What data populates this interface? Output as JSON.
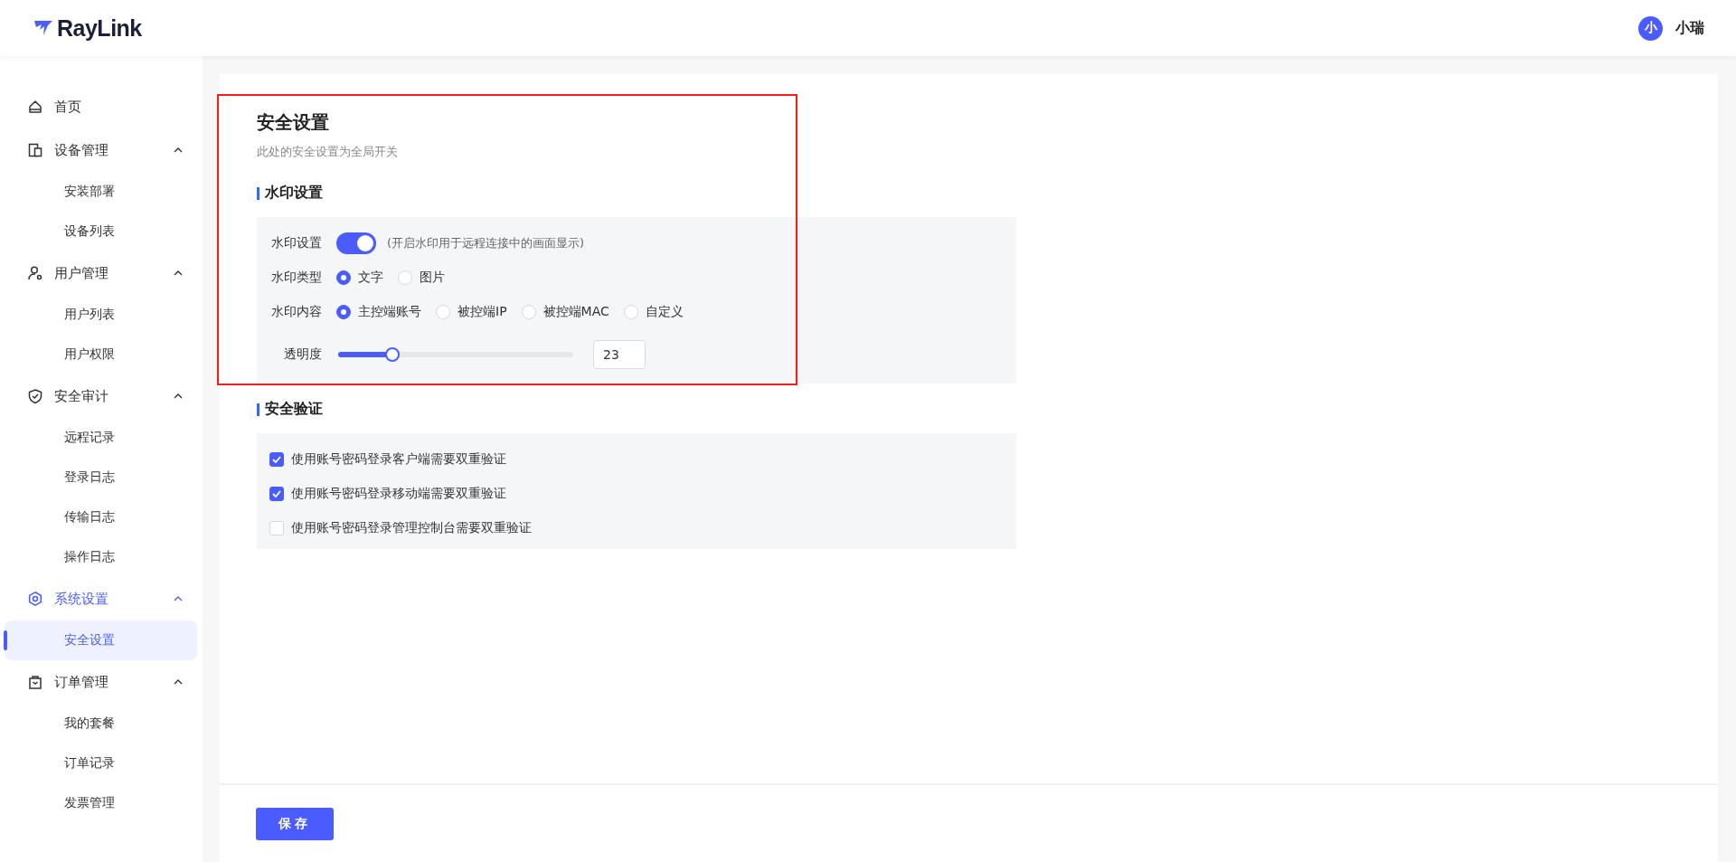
{
  "header": {
    "logo": "RayLink",
    "user": {
      "avatar": "小",
      "name": "小瑞"
    }
  },
  "sidebar": {
    "items": [
      {
        "label": "首页",
        "selected": false
      },
      {
        "label": "设备管理",
        "expanded": true,
        "selected": false,
        "children": [
          {
            "label": "安装部署",
            "selected": false
          },
          {
            "label": "设备列表",
            "selected": false
          }
        ]
      },
      {
        "label": "用户管理",
        "expanded": true,
        "selected": false,
        "children": [
          {
            "label": "用户列表",
            "selected": false
          },
          {
            "label": "用户权限",
            "selected": false
          }
        ]
      },
      {
        "label": "安全审计",
        "expanded": true,
        "selected": false,
        "children": [
          {
            "label": "远程记录",
            "selected": false
          },
          {
            "label": "登录日志",
            "selected": false
          },
          {
            "label": "传输日志",
            "selected": false
          },
          {
            "label": "操作日志",
            "selected": false
          }
        ]
      },
      {
        "label": "系统设置",
        "expanded": true,
        "selected": true,
        "children": [
          {
            "label": "安全设置",
            "selected": true
          }
        ]
      },
      {
        "label": "订单管理",
        "expanded": true,
        "selected": false,
        "children": [
          {
            "label": "我的套餐",
            "selected": false
          },
          {
            "label": "订单记录",
            "selected": false
          },
          {
            "label": "发票管理",
            "selected": false
          }
        ]
      }
    ]
  },
  "page": {
    "title": "安全设置",
    "subtitle": "此处的安全设置为全局开关"
  },
  "watermark_section": {
    "title": "水印设置",
    "toggle": {
      "label": "水印设置",
      "on": true,
      "hint": "(开启水印用于远程连接中的画面显示)"
    },
    "type": {
      "label": "水印类型",
      "options": [
        {
          "label": "文字",
          "selected": true
        },
        {
          "label": "图片",
          "selected": false
        }
      ]
    },
    "content": {
      "label": "水印内容",
      "options": [
        {
          "label": "主控端账号",
          "selected": true
        },
        {
          "label": "被控端IP",
          "selected": false
        },
        {
          "label": "被控端MAC",
          "selected": false
        },
        {
          "label": "自定义",
          "selected": false
        }
      ]
    },
    "opacity": {
      "label": "透明度",
      "level": 0.23,
      "value": "23"
    }
  },
  "verification_section": {
    "title": "安全验证",
    "options": [
      {
        "label": "使用账号密码登录客户端需要双重验证",
        "checked": true
      },
      {
        "label": "使用账号密码登录移动端需要双重验证",
        "checked": true
      },
      {
        "label": "使用账号密码登录管理控制台需要双重验证",
        "checked": false
      }
    ]
  },
  "footer": {
    "save_button": "保存"
  }
}
